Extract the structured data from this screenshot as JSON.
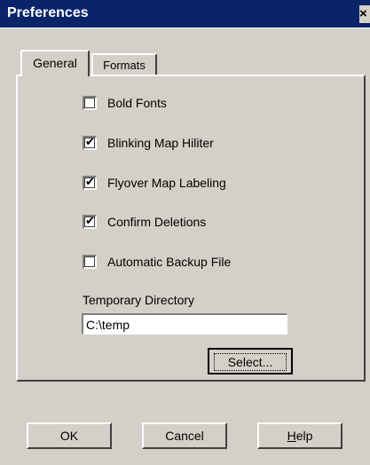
{
  "window": {
    "title": "Preferences",
    "close_glyph": "×"
  },
  "tabs": [
    {
      "label": "General",
      "active": true
    },
    {
      "label": "Formats",
      "active": false
    }
  ],
  "options": [
    {
      "label": "Bold Fonts",
      "checked": false
    },
    {
      "label": "Blinking Map Hiliter",
      "checked": true
    },
    {
      "label": "Flyover Map Labeling",
      "checked": true
    },
    {
      "label": "Confirm Deletions",
      "checked": true
    },
    {
      "label": "Automatic Backup File",
      "checked": false
    }
  ],
  "temp_dir": {
    "label": "Temporary Directory",
    "value": "C:\\temp"
  },
  "buttons": {
    "select": "Select...",
    "ok": "OK",
    "cancel": "Cancel",
    "help_prefix": "",
    "help_underlined": "H",
    "help_rest": "elp"
  },
  "check_glyph": "✔",
  "colors": {
    "titlebar": "#0a246a",
    "face": "#d4d0c8"
  }
}
